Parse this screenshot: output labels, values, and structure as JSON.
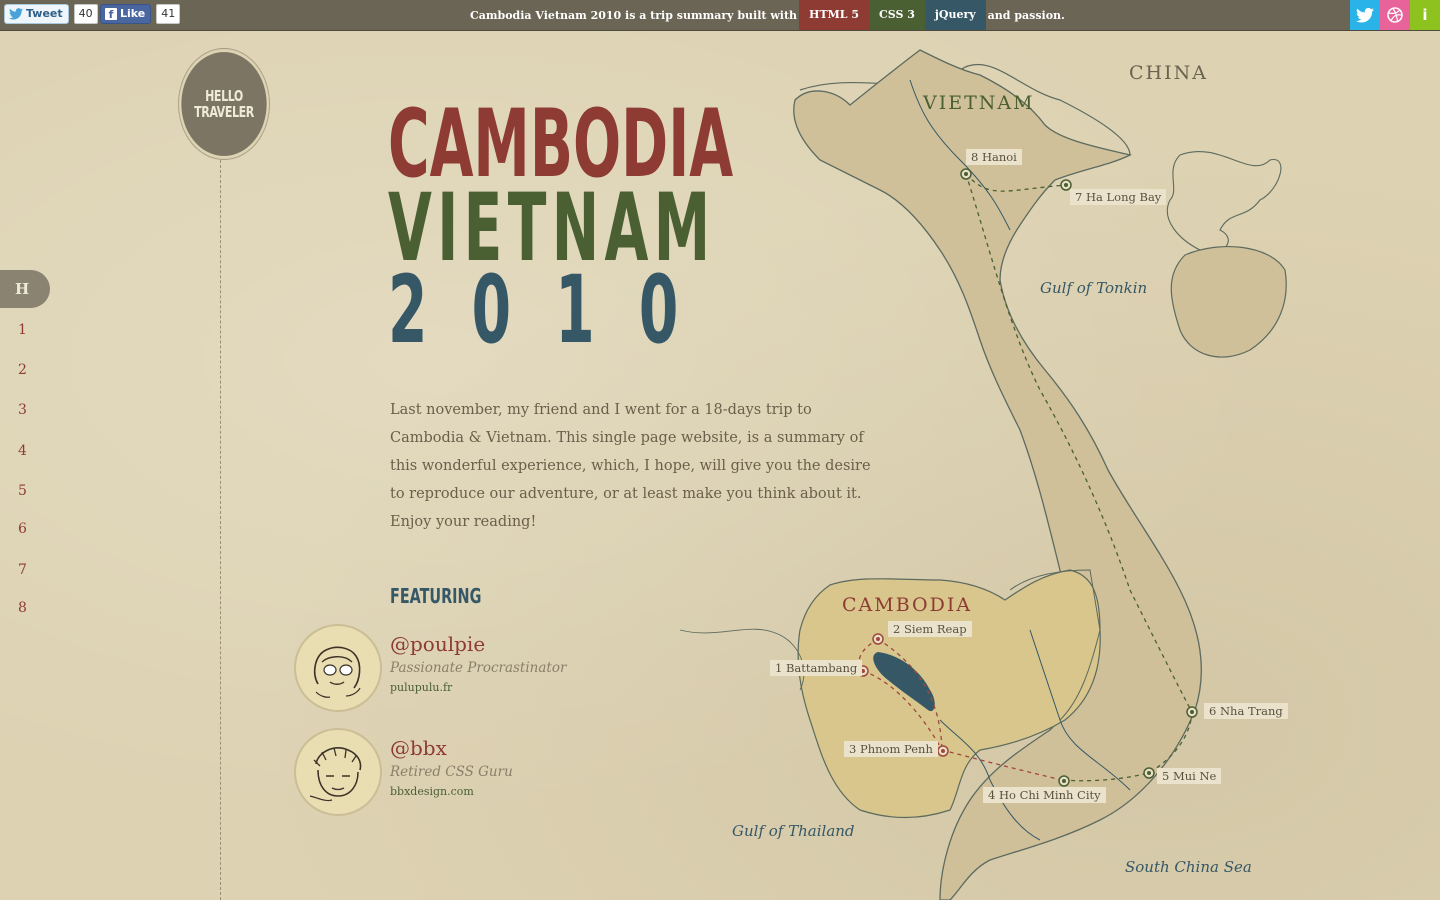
{
  "topbar": {
    "tweet_label": "Tweet",
    "tweet_count": "40",
    "like_label": "Like",
    "like_count": "41",
    "tagline_before": "Cambodia Vietnam 2010 is a trip summary built with",
    "tech": [
      "HTML 5",
      "CSS 3",
      "jQuery"
    ],
    "tagline_after": "and passion.",
    "social_icons": [
      "twitter-icon",
      "dribbble-icon",
      "info-icon"
    ],
    "info_glyph": "i"
  },
  "hello": {
    "line1": "HELLO",
    "line2": "TRAVELER"
  },
  "nav": {
    "items": [
      "H",
      "1",
      "2",
      "3",
      "4",
      "5",
      "6",
      "7",
      "8"
    ],
    "active": "H"
  },
  "title": {
    "line1": "CAMBODIA",
    "line2": "VIETNAM",
    "line3": "2010"
  },
  "intro": "Last november, my friend and I went for a 18-days trip to Cambodia & Vietnam. This single page website, is a summary of this wonderful experience, which, I hope, will give you the desire to reproduce our adventure, or at least make you think about it. Enjoy your reading!",
  "featuring": {
    "heading": "FEATURING",
    "people": [
      {
        "handle": "@poulpie",
        "role": "Passionate Procrastinator",
        "site": "pulupulu.fr"
      },
      {
        "handle": "@bbx",
        "role": "Retired CSS Guru",
        "site": "bbxdesign.com"
      }
    ]
  },
  "map": {
    "country_labels": {
      "china": "CHINA",
      "vietnam": "VIETNAM",
      "cambodia": "CAMBODIA"
    },
    "water_labels": {
      "tonkin": "Gulf of Tonkin",
      "thailand": "Gulf of Thailand",
      "south_china_sea": "South China Sea"
    },
    "places": [
      {
        "label": "1 Battambang"
      },
      {
        "label": "2 Siem Reap"
      },
      {
        "label": "3 Phnom Penh"
      },
      {
        "label": "4 Ho Chi Minh City"
      },
      {
        "label": "5 Mui Ne"
      },
      {
        "label": "6 Nha Trang"
      },
      {
        "label": "7 Ha Long Bay"
      },
      {
        "label": "8 Hanoi"
      }
    ],
    "colors": {
      "cambodia_route": "#a0473d",
      "vietnam_route": "#4a5f32",
      "land": "#cfc09a",
      "cambodia_land": "#d8c68c"
    }
  }
}
